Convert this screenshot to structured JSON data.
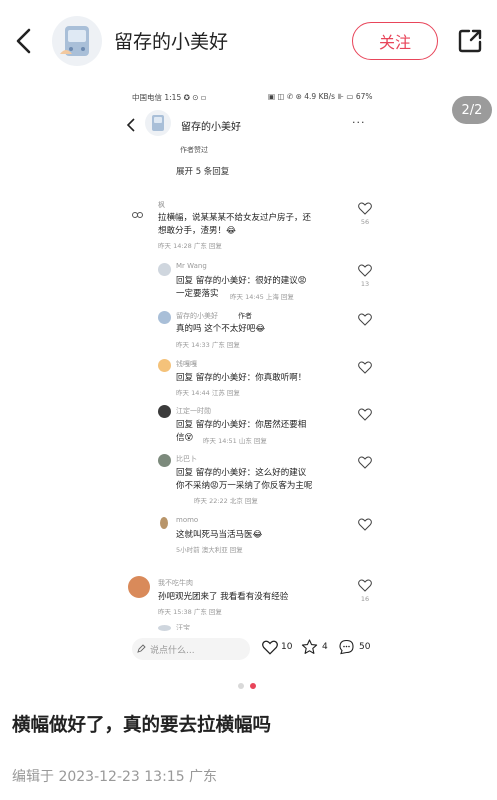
{
  "header": {
    "username": "留存的小美好",
    "follow_label": "关注"
  },
  "pager": "2/2",
  "shot": {
    "status_left": "中国电信 1:15 ✪ ⊙ ▫",
    "status_right": "▣ ◫ ✆ ⊛ 4.9 KB/s ⊪ ▭ 67%",
    "username": "留存的小美好",
    "more": "···",
    "author_liked": "作者赞过",
    "expand": "展开 5 条回复",
    "comments": [
      {
        "name": "枫",
        "text1": "拉横幅，说某某某不给女友过户房子，还",
        "text2": "想敢分手，渣男！😂",
        "meta": "昨天 14:28 广东 回复",
        "likes": "56"
      },
      {
        "name": "Mr Wang",
        "text1": "回复  留存的小美好：很好的建议😡",
        "text2": "一定要落实",
        "meta": "昨天 14:45 上海 回复",
        "likes": "13"
      },
      {
        "name": "留存的小美好",
        "tag": "作者",
        "text1": "真的吗 这个不太好吧😂",
        "meta": "昨天 14:33 广东 回复",
        "likes": ""
      },
      {
        "name": "钱嘎嘎",
        "text1": "回复  留存的小美好：你真敢听啊！",
        "meta": "昨天 14:44 江苏 回复",
        "likes": ""
      },
      {
        "name": "江定一时勋",
        "text1": "回复  留存的小美好：你居然还要相",
        "text2": "信😵",
        "meta": "昨天 14:51 山东 回复",
        "likes": ""
      },
      {
        "name": "比巴卜",
        "text1": "回复  留存的小美好：这么好的建议",
        "text2": "你不采纳😡万一采纳了你反客为主呢",
        "meta": "昨天 22:22 北京 回复",
        "likes": ""
      },
      {
        "name": "momo",
        "text1": "这就叫死马当活马医😂",
        "meta": "5小时前 澳大利亚 回复",
        "likes": ""
      },
      {
        "name": "我不吃牛肉",
        "text1": "孙吧观光团来了 我看看有没有经验",
        "meta": "昨天 15:38 广东 回复",
        "likes": "16"
      },
      {
        "name": "汪宝",
        "text1": "",
        "meta": "",
        "likes": ""
      }
    ],
    "input_placeholder": "说点什么...",
    "likes": "10",
    "stars": "4",
    "comments_count": "50"
  },
  "post": {
    "title": "横幅做好了，真的要去拉横幅吗",
    "edited": "编辑于 2023-12-23 13:15 广东"
  },
  "colors": {
    "accent": "#e8455a",
    "muted": "#999999"
  }
}
